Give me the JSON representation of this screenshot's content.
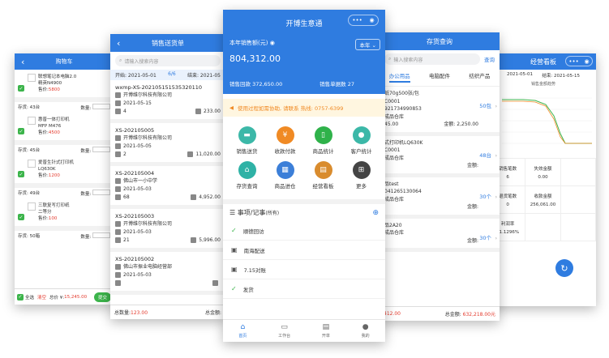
{
  "cart": {
    "title": "购物车",
    "items": [
      {
        "name": "联想笔记本电脑2.0",
        "sub": "精英N4900",
        "stock": "存货: 43台",
        "qty_label": "数量:",
        "price_label": "售价:",
        "price": "5800"
      },
      {
        "name": "惠普一体打印机",
        "sub": "MFP M476",
        "stock": "存货: 45台",
        "qty_label": "数量:",
        "price_label": "售价:",
        "price": "4500"
      },
      {
        "name": "爱普生针式打印机",
        "sub": "LQ630K",
        "stock": "存货: 49台",
        "qty_label": "数量:",
        "price_label": "售价:",
        "price": "1200"
      },
      {
        "name": "三联复写打印纸",
        "sub": "二等分",
        "stock": "存货: 50箱",
        "qty_label": "数量:",
        "price_label": "售价:",
        "price": "100"
      }
    ],
    "footer": {
      "all": "全选",
      "clear": "清空",
      "total_label": "总价 ¥:",
      "total": "15,245.00",
      "btn": "提交"
    }
  },
  "sales": {
    "title": "销售送货单",
    "search_placeholder": "请输入搜索内容",
    "count": "6/6",
    "start": "开始: 2021-05-01",
    "end": "结束: 2021-05",
    "orders": [
      {
        "no": "wxmp-XS-20210515153532011​0",
        "customer": "开博维尔科技有限公司",
        "date": "2021-05-15",
        "qty": "4",
        "amount": "233.00"
      },
      {
        "no": "XS-202105005",
        "customer": "开博维尔科技有限公司",
        "date": "2021-05-05",
        "qty": "2",
        "amount": "11,020.00"
      },
      {
        "no": "XS-202105004",
        "customer": "佛山市一小中学",
        "date": "2021-05-03",
        "qty": "68",
        "amount": "4,952.00"
      },
      {
        "no": "XS-202105003",
        "customer": "开博维尔科技有限公司",
        "date": "2021-05-03",
        "qty": "21",
        "amount": "5,996.00"
      },
      {
        "no": "XS-202105002",
        "customer": "佛山市振业电脑经营部",
        "date": "2021-05-03",
        "qty": "",
        "amount": ""
      }
    ],
    "footer": {
      "qty_label": "总数量:",
      "qty": "123.00",
      "amount_label": "总金额:"
    }
  },
  "home": {
    "title": "开博生意通",
    "capsule_dots": "•••",
    "sales_label": "本年销售额(元)",
    "sales_value": "804,312.00",
    "period": "本年",
    "returns": "销售回款 372,650.00",
    "orders": "销售单据数 27",
    "notice": "使用过程如需协助, 请联系 热线: 0757-6399",
    "tiles": [
      {
        "label": "销售送货",
        "color": "#3cb8a8",
        "icon": "truck-icon",
        "glyph": "▬"
      },
      {
        "label": "收款付款",
        "color": "#f08a24",
        "icon": "yen-icon",
        "glyph": "¥"
      },
      {
        "label": "商品统计",
        "color": "#2fb24a",
        "icon": "phone-icon",
        "glyph": "▯"
      },
      {
        "label": "客户统计",
        "color": "#3cb8a8",
        "icon": "person-icon",
        "glyph": "●"
      },
      {
        "label": "存货查询",
        "color": "#2fb2a6",
        "icon": "house-icon",
        "glyph": "⌂"
      },
      {
        "label": "商品进仓",
        "color": "#3c7fd8",
        "icon": "warehouse-icon",
        "glyph": "▦"
      },
      {
        "label": "经营看板",
        "color": "#d98c2e",
        "icon": "chart-board-icon",
        "glyph": "▤"
      },
      {
        "label": "更多",
        "color": "#444444",
        "icon": "grid-more-icon",
        "glyph": "⊞"
      }
    ],
    "memo_title": "事项/记事",
    "memo_sub": "(所有)",
    "memos": [
      {
        "text": "顺德回访",
        "done": true
      },
      {
        "text": "南海配送",
        "done": false
      },
      {
        "text": "7.15对账",
        "done": false
      },
      {
        "text": "发货",
        "done": true
      }
    ],
    "tabbar": [
      "首页",
      "工作台",
      "开单",
      "我的"
    ]
  },
  "stock": {
    "title": "存货查询",
    "search_placeholder": "输入搜索内容",
    "search_btn": "查询",
    "tabs": [
      "办公用品",
      "电脑配件",
      "纺织产品"
    ],
    "products": [
      {
        "l1": "纸70g500张/包",
        "l2": "C0001",
        "l3": "921734990853",
        "l4": "成品仓库",
        "price": "45.00",
        "amount_label": "金额:",
        "amount": "2,250.00",
        "count": "50包"
      },
      {
        "l1": "式打印机LQ630K",
        "l2": "C0001",
        "l3": "",
        "l4": "成品仓库",
        "price": "",
        "amount_label": "金额:",
        "amount": "",
        "count": "48台"
      },
      {
        "l1": "品test",
        "l2": "",
        "l3": "041265130064",
        "l4": "成品仓库",
        "price": "",
        "amount_label": "金额:",
        "amount": "",
        "count": "30个"
      },
      {
        "l1": "品2A20",
        "l2": "",
        "l3": "",
        "l4": "成品仓库",
        "price": "",
        "amount_label": "金额:",
        "amount": "",
        "count": "30个"
      }
    ],
    "footer": {
      "qty": "412.00",
      "amount_label": "总金额:",
      "amount": "632,218.00元"
    }
  },
  "board": {
    "title": "经营看板",
    "start": "2021-05-01",
    "end": "结束: 2021-05-15",
    "chart_caption": "销售金额趋势",
    "stats": [
      {
        "label": "销售笔数",
        "value": "6"
      },
      {
        "label": "失效金额",
        "value": "0.00"
      },
      {
        "label": "",
        "value": ""
      },
      {
        "label": "退货笔数",
        "value": "0"
      },
      {
        "label": "收款金额",
        "value": "256,061.00"
      },
      {
        "label": "",
        "value": ""
      },
      {
        "label": "利润率",
        "value": "51.1296%"
      },
      {
        "label": "",
        "value": ""
      },
      {
        "label": "",
        "value": ""
      }
    ]
  }
}
